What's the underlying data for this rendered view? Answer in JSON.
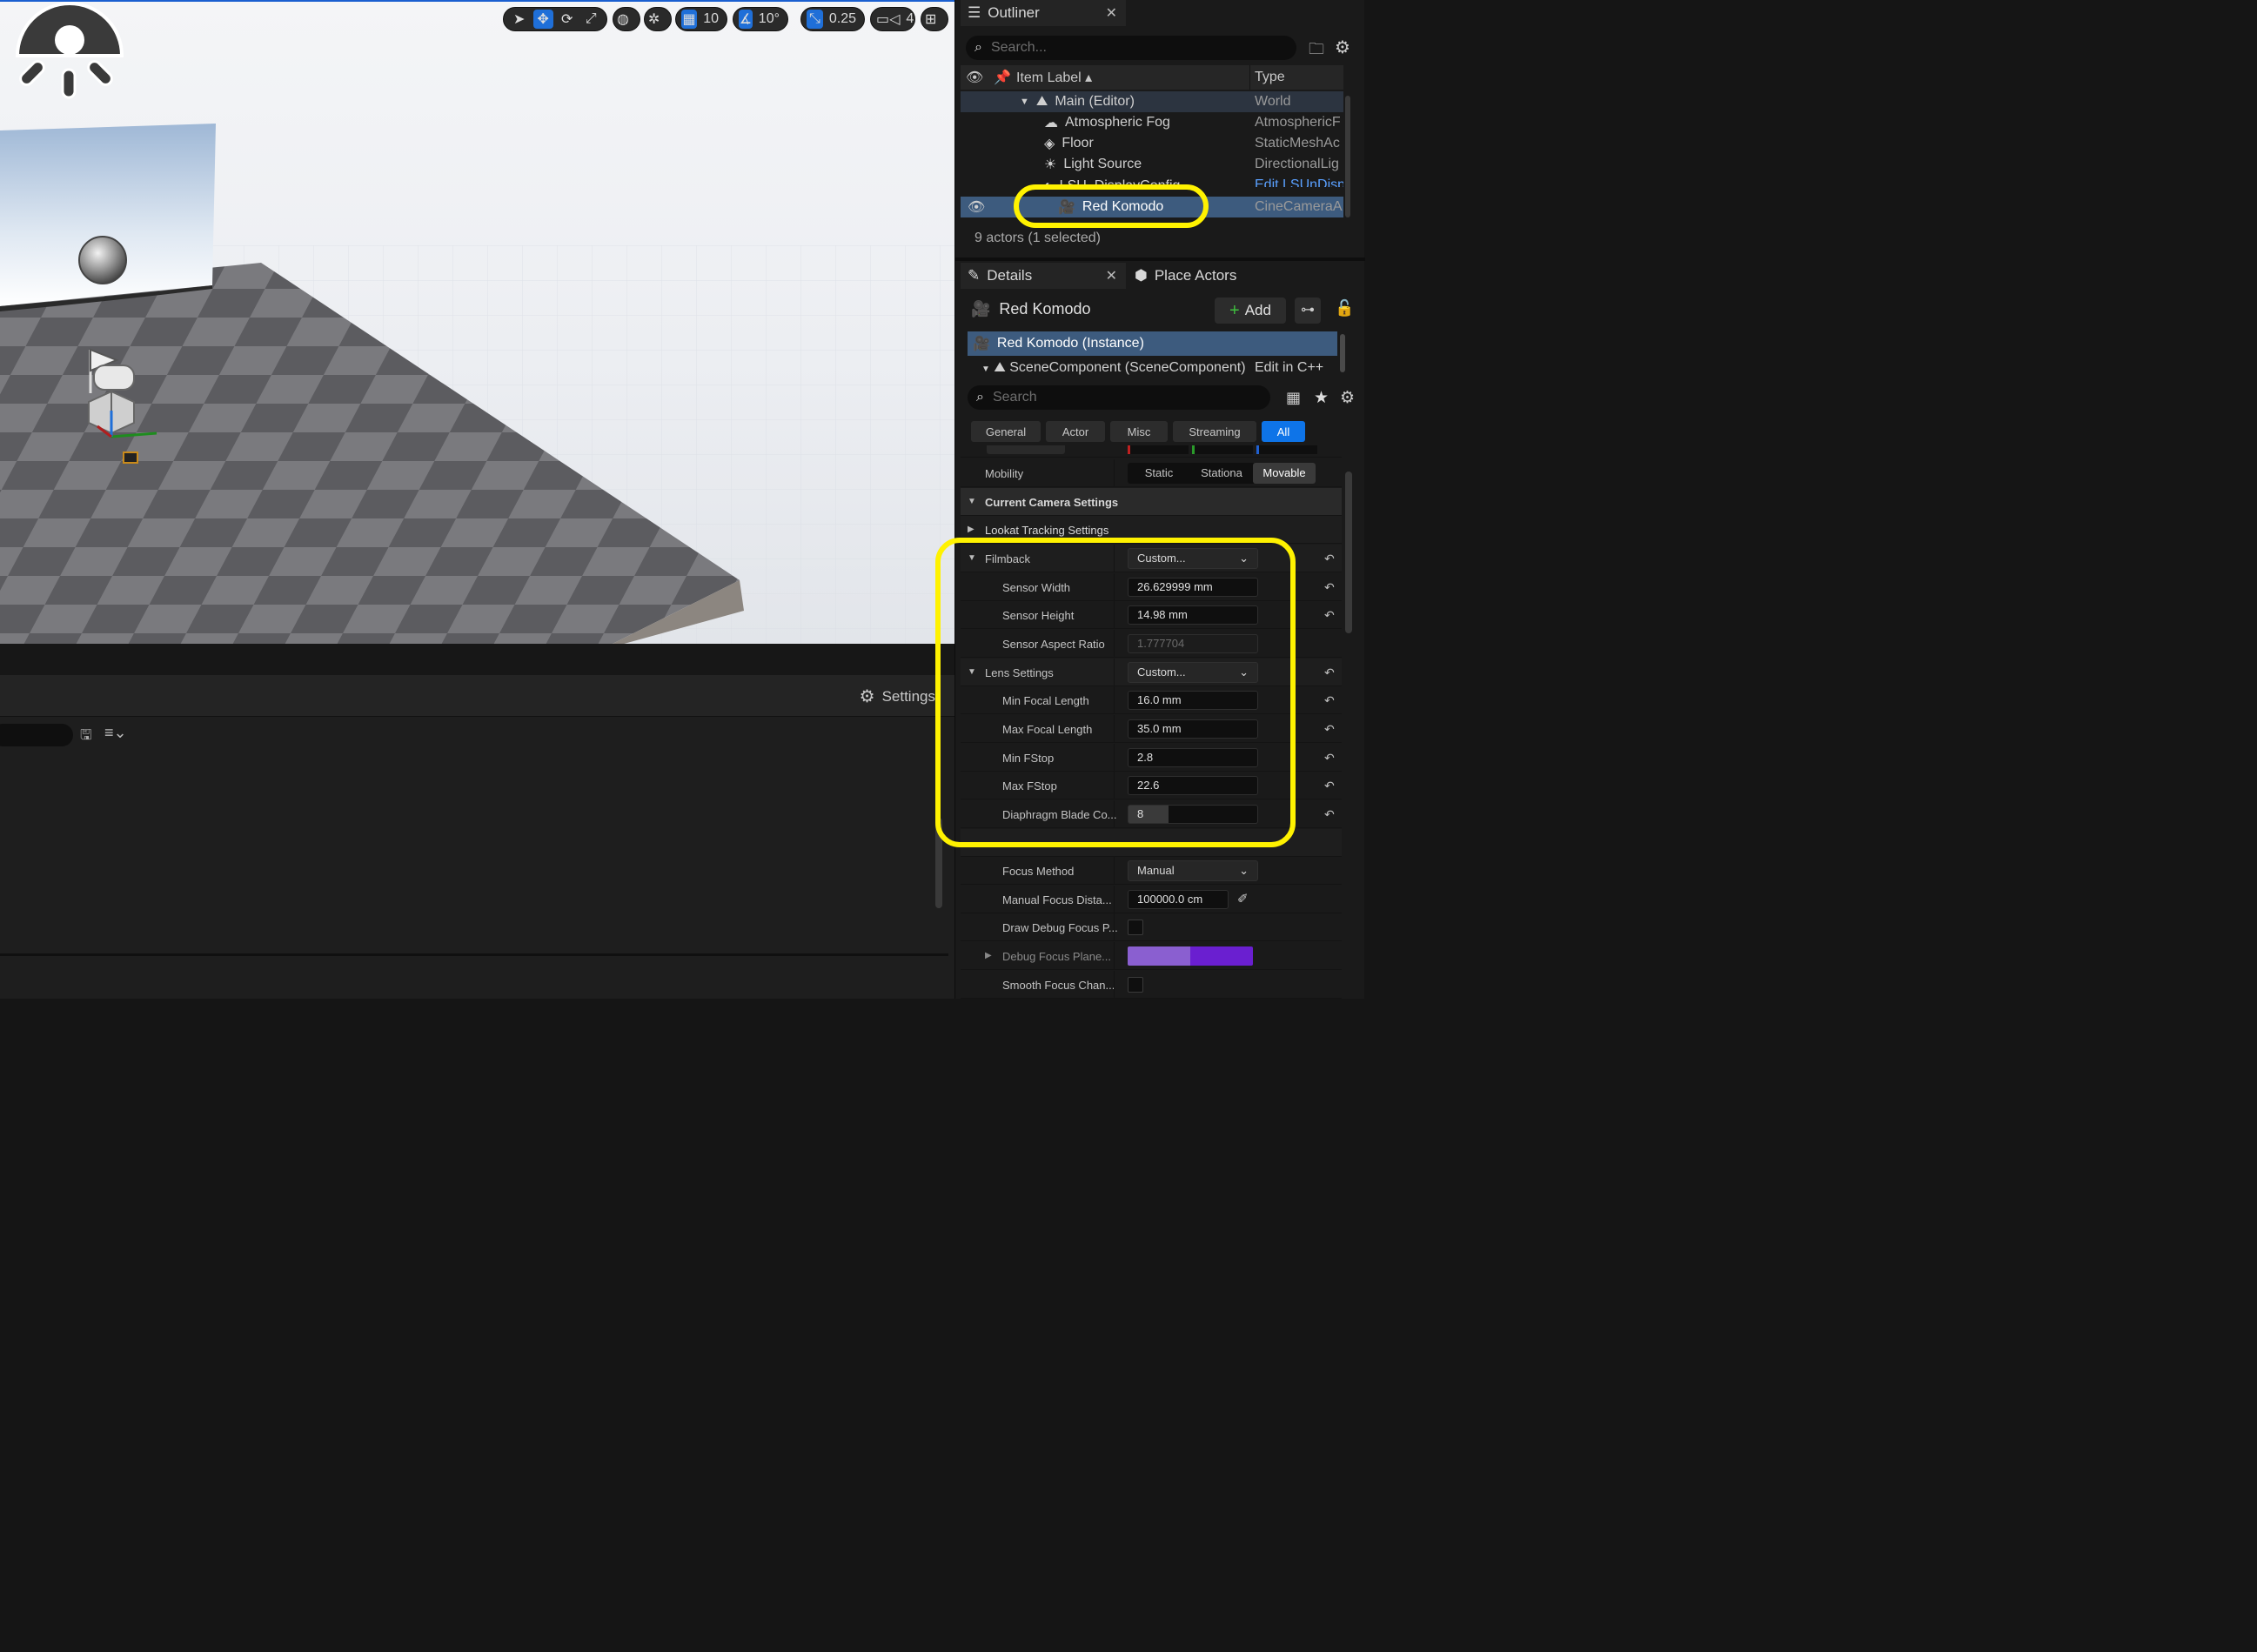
{
  "viewport": {
    "toolbar": {
      "snap_grid": "10",
      "snap_angle": "10°",
      "snap_scale": "0.25",
      "camera_speed": "4"
    }
  },
  "content_panel": {
    "settings_label": "Settings"
  },
  "outliner": {
    "tab_title": "Outliner",
    "search_placeholder": "Search...",
    "col_label": "Item Label",
    "col_type": "Type",
    "rows": [
      {
        "label": "Main (Editor)",
        "type": "World"
      },
      {
        "label": "Atmospheric Fog",
        "type": "AtmosphericF"
      },
      {
        "label": "Floor",
        "type": "StaticMeshAc"
      },
      {
        "label": "Light Source",
        "type": "DirectionalLig"
      },
      {
        "label": "LSU_DisplayConfig",
        "type": "Edit LSUnDisp"
      },
      {
        "label": "Red Komodo",
        "type": "CineCameraA"
      }
    ],
    "status": "9 actors (1 selected)"
  },
  "details": {
    "tab_title": "Details",
    "place_actors_tab": "Place Actors",
    "actor_name": "Red Komodo",
    "add_label": "Add",
    "instance_label": "Red Komodo (Instance)",
    "component_label": "SceneComponent (SceneComponent)",
    "edit_cpp": "Edit in C++",
    "search_placeholder": "Search",
    "categories": [
      "General",
      "Actor",
      "Misc",
      "Streaming",
      "All"
    ],
    "mobility": {
      "label": "Mobility",
      "options": [
        "Static",
        "Stationa",
        "Movable"
      ],
      "selected": "Movable"
    },
    "sections": {
      "current_camera": "Current Camera Settings",
      "lookat": "Lookat Tracking Settings"
    },
    "filmback": {
      "label": "Filmback",
      "value": "Custom..."
    },
    "sensor_width": {
      "label": "Sensor Width",
      "value": "26.629999 mm"
    },
    "sensor_height": {
      "label": "Sensor Height",
      "value": "14.98 mm"
    },
    "sensor_aspect": {
      "label": "Sensor Aspect Ratio",
      "value": "1.777704"
    },
    "lens": {
      "label": "Lens Settings",
      "value": "Custom..."
    },
    "min_focal": {
      "label": "Min Focal Length",
      "value": "16.0 mm"
    },
    "max_focal": {
      "label": "Max Focal Length",
      "value": "35.0 mm"
    },
    "min_fstop": {
      "label": "Min FStop",
      "value": "2.8"
    },
    "max_fstop": {
      "label": "Max FStop",
      "value": "22.6"
    },
    "diaphragm": {
      "label": "Diaphragm Blade Co...",
      "value": "8"
    },
    "focus_method": {
      "label": "Focus Method",
      "value": "Manual"
    },
    "manual_focus": {
      "label": "Manual Focus Dista...",
      "value": "100000.0 cm"
    },
    "draw_debug": {
      "label": "Draw Debug Focus P..."
    },
    "debug_plane": {
      "label": "Debug Focus Plane..."
    },
    "smooth_focus": {
      "label": "Smooth Focus Chan..."
    }
  },
  "colors": {
    "accent": "#0e74e8",
    "highlight": "#fff200",
    "selection": "#3d5b7e",
    "debug_plane": "#6a1fd0"
  }
}
